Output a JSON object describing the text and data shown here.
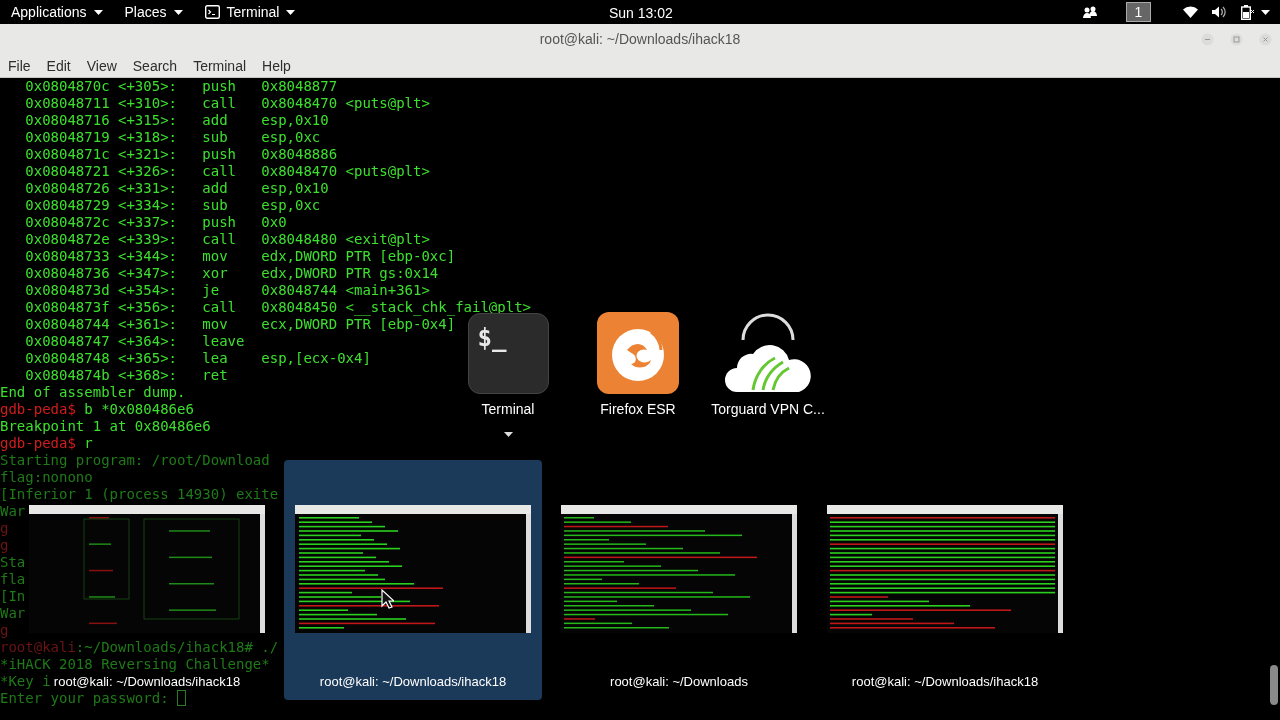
{
  "top_bar": {
    "menus": [
      {
        "label": "Applications",
        "kind": "menu"
      },
      {
        "label": "Places",
        "kind": "menu"
      },
      {
        "label": "Terminal",
        "kind": "app"
      }
    ],
    "clock": "Sun 13:02",
    "workspace": "1"
  },
  "window": {
    "title": "root@kali: ~/Downloads/ihack18",
    "menu": [
      "File",
      "Edit",
      "View",
      "Search",
      "Terminal",
      "Help"
    ]
  },
  "terminal": {
    "lines": [
      {
        "dimmed": false,
        "parts": [
          {
            "kind": "out",
            "text": "   0x0804870c <+305>:   push   0x8048877"
          }
        ]
      },
      {
        "dimmed": false,
        "parts": [
          {
            "kind": "out",
            "text": "   0x08048711 <+310>:   call   0x8048470 <puts@plt>"
          }
        ]
      },
      {
        "dimmed": false,
        "parts": [
          {
            "kind": "out",
            "text": "   0x08048716 <+315>:   add    esp,0x10"
          }
        ]
      },
      {
        "dimmed": false,
        "parts": [
          {
            "kind": "out",
            "text": "   0x08048719 <+318>:   sub    esp,0xc"
          }
        ]
      },
      {
        "dimmed": false,
        "parts": [
          {
            "kind": "out",
            "text": "   0x0804871c <+321>:   push   0x8048886"
          }
        ]
      },
      {
        "dimmed": false,
        "parts": [
          {
            "kind": "out",
            "text": "   0x08048721 <+326>:   call   0x8048470 <puts@plt>"
          }
        ]
      },
      {
        "dimmed": false,
        "parts": [
          {
            "kind": "out",
            "text": "   0x08048726 <+331>:   add    esp,0x10"
          }
        ]
      },
      {
        "dimmed": false,
        "parts": [
          {
            "kind": "out",
            "text": "   0x08048729 <+334>:   sub    esp,0xc"
          }
        ]
      },
      {
        "dimmed": false,
        "parts": [
          {
            "kind": "out",
            "text": "   0x0804872c <+337>:   push   0x0"
          }
        ]
      },
      {
        "dimmed": false,
        "parts": [
          {
            "kind": "out",
            "text": "   0x0804872e <+339>:   call   0x8048480 <exit@plt>"
          }
        ]
      },
      {
        "dimmed": false,
        "parts": [
          {
            "kind": "out",
            "text": "   0x08048733 <+344>:   mov    edx,DWORD PTR [ebp-0xc]"
          }
        ]
      },
      {
        "dimmed": false,
        "parts": [
          {
            "kind": "out",
            "text": "   0x08048736 <+347>:   xor    edx,DWORD PTR gs:0x14"
          }
        ]
      },
      {
        "dimmed": false,
        "parts": [
          {
            "kind": "out",
            "text": "   0x0804873d <+354>:   je     0x8048744 <main+361>"
          }
        ]
      },
      {
        "dimmed": false,
        "parts": [
          {
            "kind": "out",
            "text": "   0x0804873f <+356>:   call   0x8048450 <__stack_chk_fail@plt>"
          }
        ]
      },
      {
        "dimmed": false,
        "parts": [
          {
            "kind": "out",
            "text": "   0x08048744 <+361>:   mov    ecx,DWORD PTR [ebp-0x4]"
          }
        ]
      },
      {
        "dimmed": false,
        "parts": [
          {
            "kind": "out",
            "text": "   0x08048747 <+364>:   leave"
          }
        ]
      },
      {
        "dimmed": false,
        "parts": [
          {
            "kind": "out",
            "text": "   0x08048748 <+365>:   lea    esp,[ecx-0x4]"
          }
        ]
      },
      {
        "dimmed": false,
        "parts": [
          {
            "kind": "out",
            "text": "   0x0804874b <+368>:   ret"
          }
        ]
      },
      {
        "dimmed": false,
        "parts": [
          {
            "kind": "out",
            "text": "End of assembler dump."
          }
        ]
      },
      {
        "dimmed": false,
        "parts": [
          {
            "kind": "prompt",
            "text": "gdb-peda$ "
          },
          {
            "kind": "out",
            "text": "b *0x080486e6"
          }
        ]
      },
      {
        "dimmed": false,
        "parts": [
          {
            "kind": "out",
            "text": "Breakpoint 1 at 0x80486e6"
          }
        ]
      },
      {
        "dimmed": false,
        "parts": [
          {
            "kind": "prompt",
            "text": "gdb-peda$ "
          },
          {
            "kind": "out",
            "text": "r"
          }
        ]
      },
      {
        "dimmed": true,
        "parts": [
          {
            "kind": "out",
            "text": "Starting program: /root/Download"
          }
        ]
      },
      {
        "dimmed": true,
        "parts": [
          {
            "kind": "out",
            "text": "flag:nonono"
          }
        ]
      },
      {
        "dimmed": true,
        "parts": [
          {
            "kind": "out",
            "text": "[Inferior 1 (process 14930) exite"
          }
        ]
      },
      {
        "dimmed": true,
        "parts": [
          {
            "kind": "out",
            "text": "War"
          }
        ]
      },
      {
        "dimmed": true,
        "parts": [
          {
            "kind": "prompt",
            "text": "g"
          }
        ]
      },
      {
        "dimmed": true,
        "parts": [
          {
            "kind": "prompt",
            "text": "g"
          }
        ]
      },
      {
        "dimmed": true,
        "parts": [
          {
            "kind": "out",
            "text": "Sta"
          }
        ]
      },
      {
        "dimmed": true,
        "parts": [
          {
            "kind": "out",
            "text": "fla"
          }
        ]
      },
      {
        "dimmed": true,
        "parts": [
          {
            "kind": "out",
            "text": "[In"
          }
        ]
      },
      {
        "dimmed": true,
        "parts": [
          {
            "kind": "out",
            "text": "War"
          }
        ]
      },
      {
        "dimmed": true,
        "parts": [
          {
            "kind": "prompt",
            "text": "g"
          }
        ]
      },
      {
        "dimmed": true,
        "parts": [
          {
            "kind": "prompt",
            "text": "root@kali"
          },
          {
            "kind": "out",
            "text": ":~/Downloads/ihack18# ./"
          }
        ]
      },
      {
        "dimmed": true,
        "parts": [
          {
            "kind": "out",
            "text": "*iHACK 2018 Reversing Challenge*"
          }
        ]
      },
      {
        "dimmed": true,
        "parts": [
          {
            "kind": "out",
            "text": "*Key i"
          }
        ]
      },
      {
        "dimmed": true,
        "cursor": true,
        "parts": [
          {
            "kind": "out",
            "text": "Enter your password: "
          }
        ]
      }
    ]
  },
  "switcher": {
    "apps": [
      {
        "label": "Terminal",
        "kind": "terminal",
        "glyph": "$_",
        "expanded": true
      },
      {
        "label": "Firefox ESR",
        "kind": "firefox",
        "expanded": false
      },
      {
        "label": "Torguard VPN C...",
        "kind": "torguard",
        "expanded": false
      }
    ],
    "windows": [
      {
        "label": "root@kali: ~/Downloads/ihack18",
        "kind": "graph",
        "selected": false
      },
      {
        "label": "root@kali: ~/Downloads/ihack18",
        "kind": "gdb",
        "selected": true
      },
      {
        "label": "root@kali: ~/Downloads",
        "kind": "shell",
        "selected": false
      },
      {
        "label": "root@kali: ~/Downloads/ihack18",
        "kind": "log",
        "selected": false
      }
    ]
  }
}
